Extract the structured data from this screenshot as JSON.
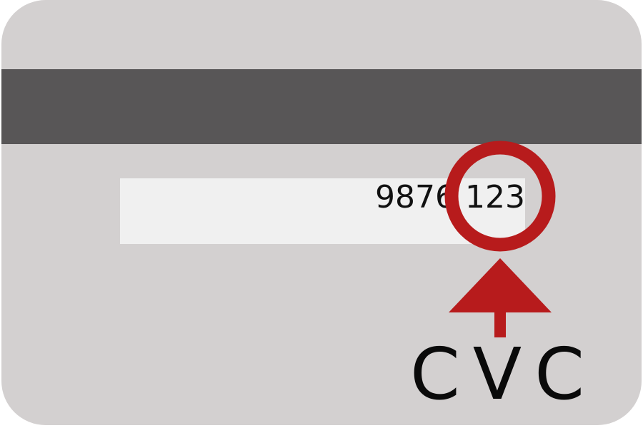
{
  "card": {
    "card_color": "#d3d0d0",
    "stripe_color": "#585657",
    "panel_color": "#f0f0f0",
    "number_text": "9876 123"
  },
  "annotation": {
    "highlight_color": "#b71b1c",
    "icons": [
      "circle-highlight-icon",
      "arrow-up-icon"
    ],
    "label": "CVC"
  }
}
